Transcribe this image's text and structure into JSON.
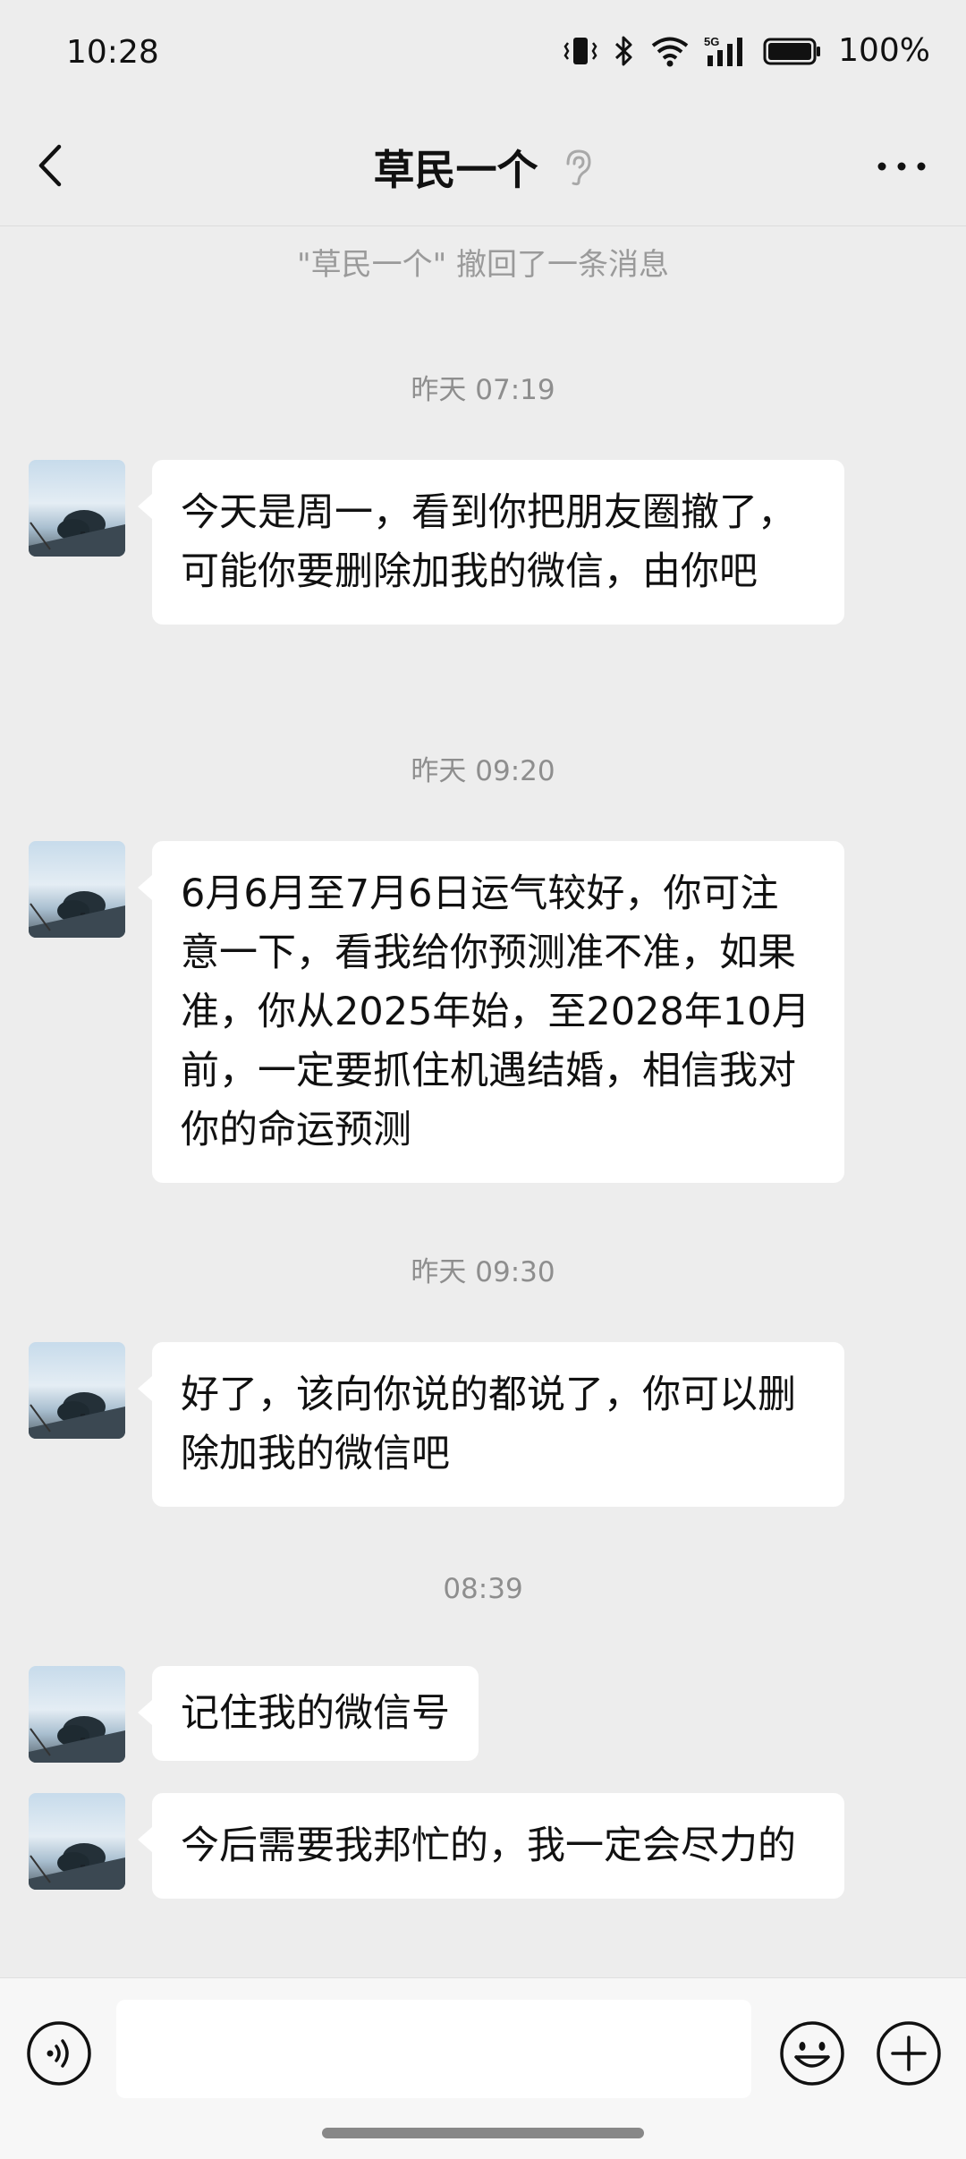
{
  "status_bar": {
    "time": "10:28",
    "battery_percent": "100%"
  },
  "header": {
    "title": "草民一个"
  },
  "system_message": "\"草民一个\" 撤回了一条消息",
  "conversation": [
    {
      "timestamp": "昨天 07:19",
      "text": "今天是周一，看到你把朋友圈撤了，可能你要删除加我的微信，由你吧"
    },
    {
      "timestamp": "昨天 09:20",
      "text": "6月6月至7月6日运气较好，你可注意一下，看我给你预测准不准，如果准，你从2025年始，至2028年10月前，一定要抓住机遇结婚，相信我对你的命运预测"
    },
    {
      "timestamp": "昨天 09:30",
      "text": "好了，该向你说的都说了，你可以删除加我的微信吧"
    },
    {
      "timestamp": "08:39",
      "text": "记住我的微信号"
    },
    {
      "timestamp": "",
      "text": "今后需要我邦忙的，我一定会尽力的"
    }
  ],
  "input": {
    "value": ""
  },
  "icons": {
    "back": "chevron-left-icon",
    "mute": "ear-icon",
    "more": "more-dots-icon",
    "voice": "voice-icon",
    "emoji": "emoji-icon",
    "plus": "plus-icon"
  }
}
